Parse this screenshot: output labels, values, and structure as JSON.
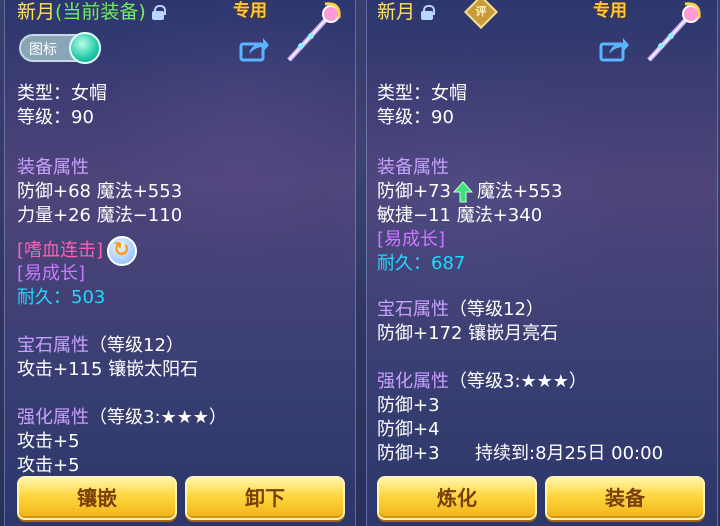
{
  "left": {
    "name": "新月",
    "tag": "(当前装备)",
    "exclusive": "专用",
    "icon_toggle_label": "图标",
    "type": "类型：女帽",
    "level": "等级：90",
    "equip_header": "装备属性",
    "attr1": "防御+68 魔法+553",
    "attr2": "力量+26 魔法−110",
    "special_skill": "[嗜血连击]",
    "special_trait": "[易成长]",
    "durability": "耐久：503",
    "gem_header": "宝石属性",
    "gem_level": "（等级12）",
    "gem_attr": "攻击+115 镶嵌太阳石",
    "enhance_header": "强化属性",
    "enhance_level": "（等级3:★★★）",
    "enhance1": "攻击+5",
    "enhance2": "攻击+5",
    "btn1": "镶嵌",
    "btn2": "卸下"
  },
  "right": {
    "name": "新月",
    "rate_badge": "评",
    "exclusive": "专用",
    "type": "类型：女帽",
    "level": "等级：90",
    "equip_header": "装备属性",
    "attr1_a": "防御+73",
    "attr1_b": "魔法+553",
    "attr2": "敏捷−11 魔法+340",
    "special_trait": "[易成长]",
    "durability": "耐久：687",
    "gem_header": "宝石属性",
    "gem_level": "（等级12）",
    "gem_attr": "防御+172 镶嵌月亮石",
    "enhance_header": "强化属性",
    "enhance_level": "（等级3:★★★）",
    "enhance1": "防御+3",
    "enhance2": "防御+4",
    "enhance3": "防御+3",
    "duration": "持续到:8月25日 00:00",
    "btn1": "炼化",
    "btn2": "装备"
  },
  "icons": {
    "lock": "lock-icon",
    "share": "share-icon",
    "weapon": "staff-weapon-icon",
    "refresh": "refresh-icon",
    "upgrade": "up-arrow-icon"
  }
}
